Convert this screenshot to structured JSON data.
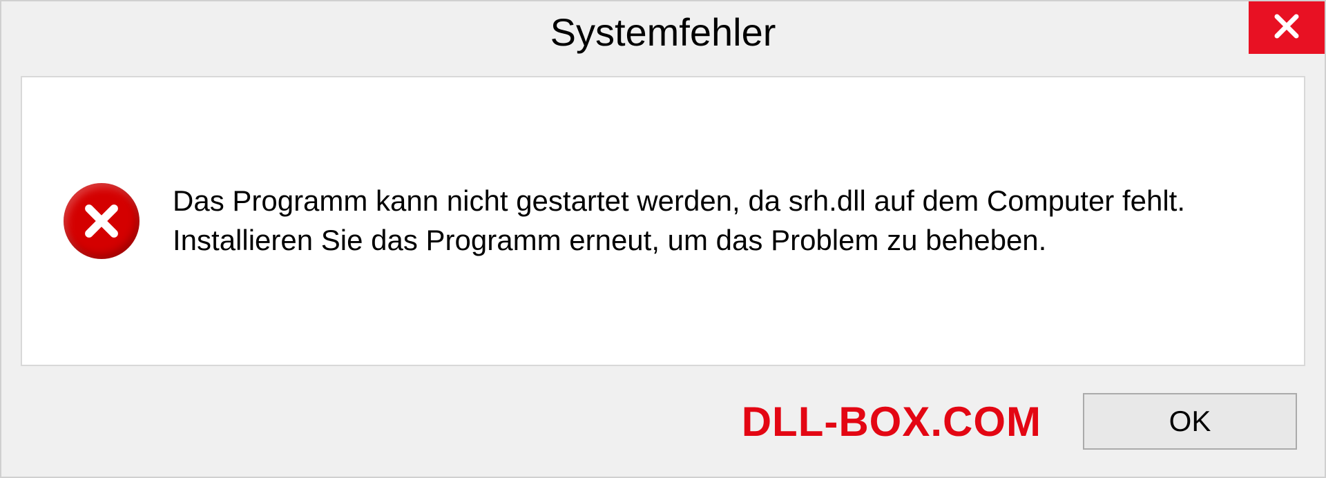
{
  "dialog": {
    "title": "Systemfehler",
    "message": "Das Programm kann nicht gestartet werden, da srh.dll auf dem Computer fehlt. Installieren Sie das Programm erneut, um das Problem zu beheben.",
    "ok_label": "OK"
  },
  "watermark": "DLL-BOX.COM",
  "colors": {
    "close_bg": "#e81123",
    "error_icon_bg": "#d40000",
    "watermark": "#e30613"
  }
}
